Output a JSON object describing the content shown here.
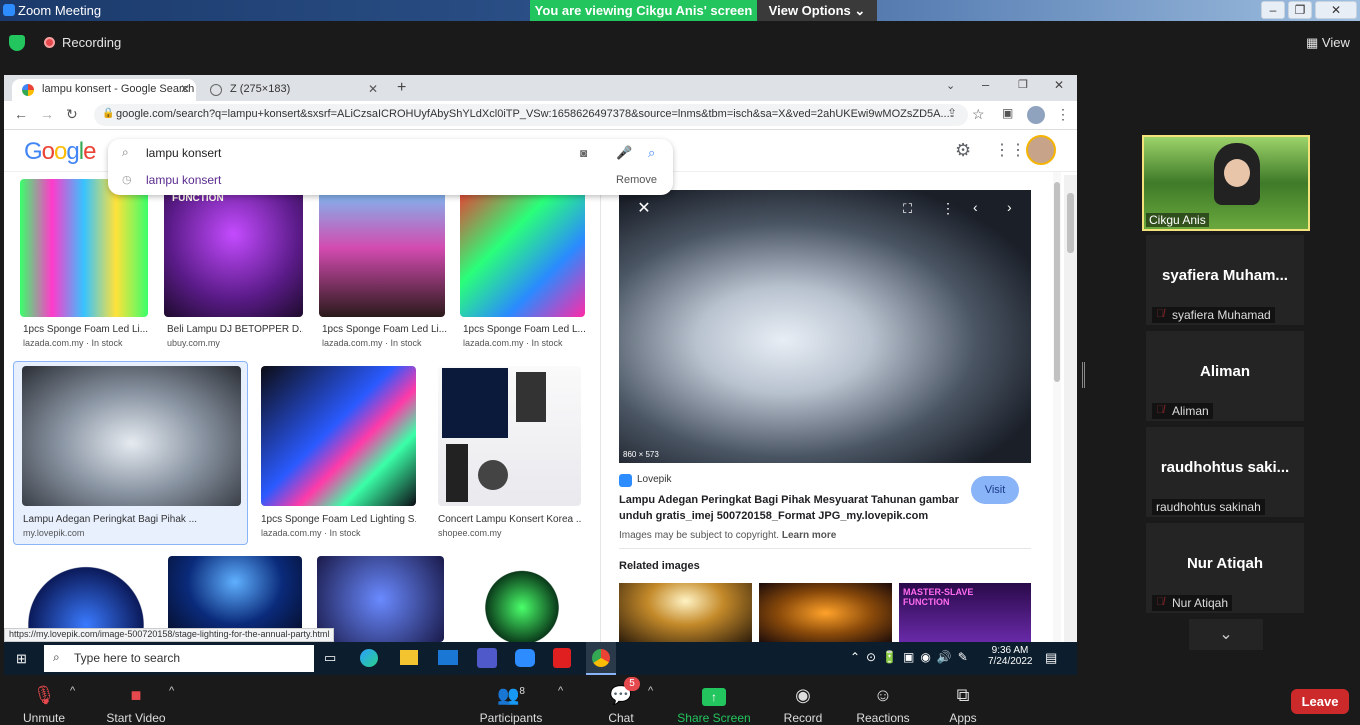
{
  "zoom": {
    "window_title": "Zoom Meeting",
    "viewing_banner": "You are viewing Cikgu Anis' screen",
    "view_options": "View Options",
    "recording": "Recording",
    "view": "View",
    "participants_count": "8",
    "chat_badge": "5",
    "toolbar": {
      "unmute": "Unmute",
      "start_video": "Start Video",
      "participants": "Participants",
      "chat": "Chat",
      "share_screen": "Share Screen",
      "record": "Record",
      "reactions": "Reactions",
      "apps": "Apps",
      "leave": "Leave"
    },
    "tiles": [
      {
        "name": "Cikgu Anis",
        "type": "video"
      },
      {
        "display": "syafiera  Muham...",
        "label": "syafiera Muhamad"
      },
      {
        "display": "Aliman",
        "label": "Aliman"
      },
      {
        "display": "raudhohtus  saki...",
        "label": "raudhohtus sakinah"
      },
      {
        "display": "Nur Atiqah",
        "label": "Nur Atiqah"
      }
    ]
  },
  "browser": {
    "tabs": [
      {
        "label": "lampu konsert - Google Search"
      },
      {
        "label": "Z (275×183)"
      }
    ],
    "url": "google.com/search?q=lampu+konsert&sxsrf=ALiCzsaICROHUyfAbyShYLdXcl0iTP_VSw:1658626497378&source=lnms&tbm=isch&sa=X&ved=2ahUKEwi9wMOZsZD5A...",
    "search_query": "lampu konsert",
    "suggestion": "lampu konsert",
    "remove": "Remove",
    "status_url": "https://my.lovepik.com/image-500720158/stage-lighting-for-the-annual-party.html",
    "results": [
      {
        "caption": "1pcs Sponge Foam Led Li...",
        "source": "lazada.com.my · In stock"
      },
      {
        "caption": "Beli Lampu DJ BETOPPER D...",
        "source": "ubuy.com.my"
      },
      {
        "caption": "1pcs Sponge Foam Led Li...",
        "source": "lazada.com.my · In stock"
      },
      {
        "caption": "1pcs Sponge Foam Led L...",
        "source": "lazada.com.my · In stock"
      },
      {
        "caption": "Lampu Adegan Peringkat Bagi Pihak ...",
        "source": "my.lovepik.com"
      },
      {
        "caption": "1pcs Sponge Foam Led Lighting S...",
        "source": "lazada.com.my · In stock"
      },
      {
        "caption": "Concert Lampu Konsert Korea ...",
        "source": "shopee.com.my"
      }
    ],
    "panel": {
      "dims": "860 × 573",
      "site": "Lovepik",
      "title": "Lampu Adegan Peringkat Bagi Pihak Mesyuarat Tahunan gambar unduh gratis_imej 500720158_Format JPG_my.lovepik.com",
      "visit": "Visit",
      "copyright": "Images may be subject to copyright.",
      "learn_more": "Learn more",
      "related": "Related images",
      "related_text": "MASTER-SLAVE FUNCTION"
    },
    "thumb_label": "FUNCTION"
  },
  "taskbar": {
    "search_placeholder": "Type here to search",
    "time": "9:36 AM",
    "date": "7/24/2022"
  },
  "colors": {
    "zoom_green": "#23c55e",
    "leave_red": "#cc2a2a",
    "google_blue": "#4285f4",
    "visit_btn": "#8ab4f8"
  }
}
